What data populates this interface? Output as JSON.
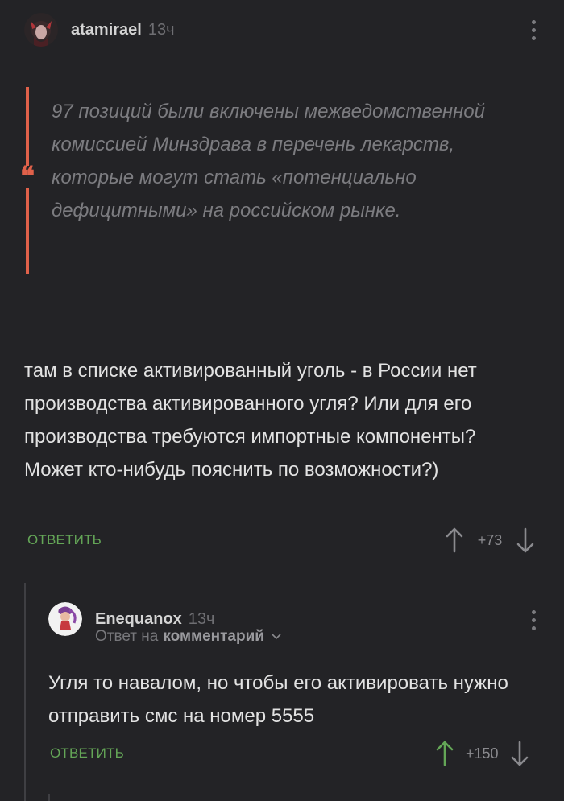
{
  "post": {
    "author": "atamirael",
    "time": "13ч",
    "quote": "97 позиций были включены межведомственной комиссией Минздрава в перечень лекарств, которые могут стать «потенциально дефицитными» на российском рынке.",
    "quote_mark": "❝",
    "text": "там в списке активированный уголь - в России нет производства активированного угля? Или для его производства требуются импортные компоненты?\nМожет кто-нибудь пояснить по возможности?)",
    "reply_label": "ОТВЕТИТЬ",
    "rating": "+73"
  },
  "reply": {
    "author": "Enequanox",
    "time": "13ч",
    "reply_to_prefix": "Ответ на",
    "reply_to_target": "комментарий",
    "text": "Угля то навалом, но чтобы его активировать нужно отправить смс на номер 5555",
    "reply_label": "ОТВЕТИТЬ",
    "rating": "+150",
    "upvoted": true
  },
  "icons": [
    "more-vertical-icon",
    "quote-icon",
    "arrow-up-icon",
    "arrow-down-icon",
    "chevron-down-icon"
  ],
  "colors": {
    "background": "#232326",
    "accent_green": "#64a657",
    "quote_bar": "#e0614a",
    "muted_text": "#7c7c80"
  }
}
